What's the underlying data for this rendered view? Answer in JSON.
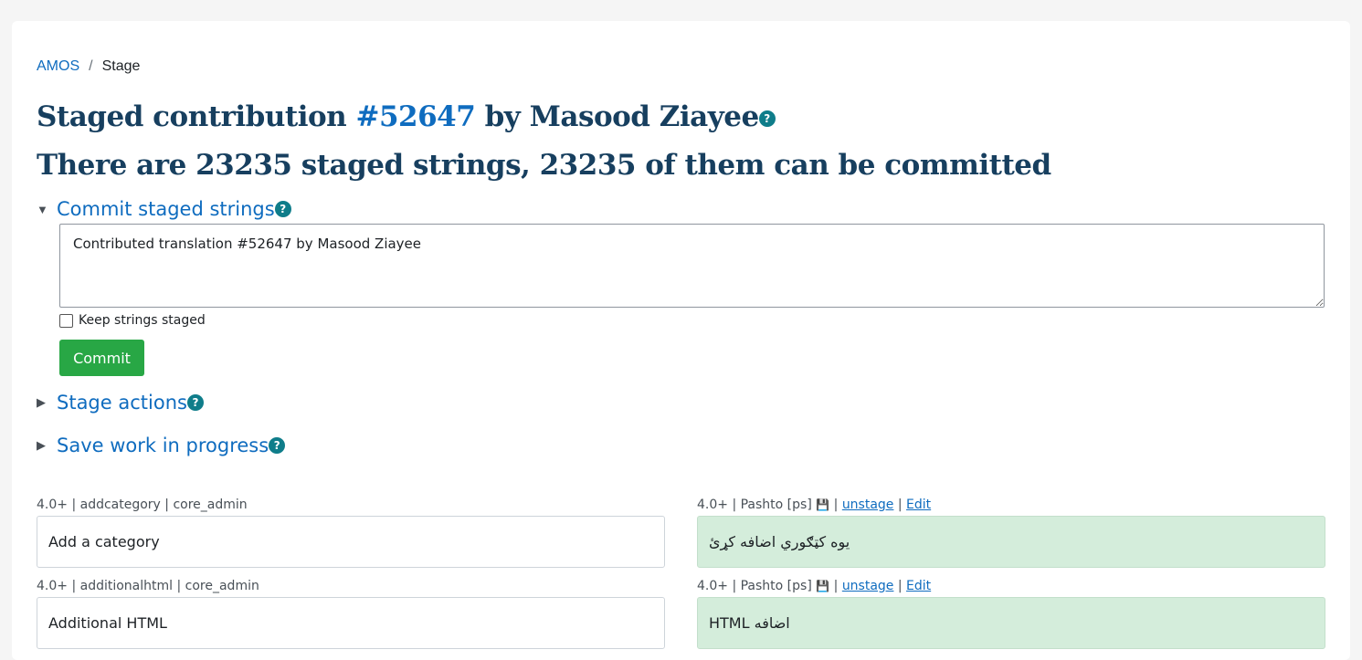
{
  "breadcrumb": {
    "root": "AMOS",
    "sep": "/",
    "current": "Stage"
  },
  "title": {
    "prefix": "Staged contribution ",
    "number": "#52647",
    "suffix": " by Masood Ziayee",
    "help": "?"
  },
  "subtitle": "There are 23235 staged strings, 23235 of them can be committed",
  "sections": {
    "commit": {
      "label": "Commit staged strings",
      "help": "?",
      "toggle": "▼"
    },
    "stage_actions": {
      "label": "Stage actions",
      "help": "?",
      "toggle": "▶"
    },
    "save_wip": {
      "label": "Save work in progress",
      "help": "?",
      "toggle": "▶"
    }
  },
  "commit_form": {
    "message": "Contributed translation #52647 by Masood Ziayee",
    "keep_label": "Keep strings staged",
    "commit_button": "Commit"
  },
  "strings": [
    {
      "source_meta": "4.0+ | addcategory | core_admin",
      "source_text": "Add a category",
      "target_meta": "4.0+ | Pashto [ps]",
      "target_text": "یوه کټګوري اضافه کړئ",
      "unstage": "unstage",
      "edit": "Edit"
    },
    {
      "source_meta": "4.0+ | additionalhtml | core_admin",
      "source_text": "Additional HTML",
      "target_meta": "4.0+ | Pashto [ps]",
      "target_text": "اضافه HTML",
      "unstage": "unstage",
      "edit": "Edit"
    }
  ],
  "meta_sep": "|"
}
